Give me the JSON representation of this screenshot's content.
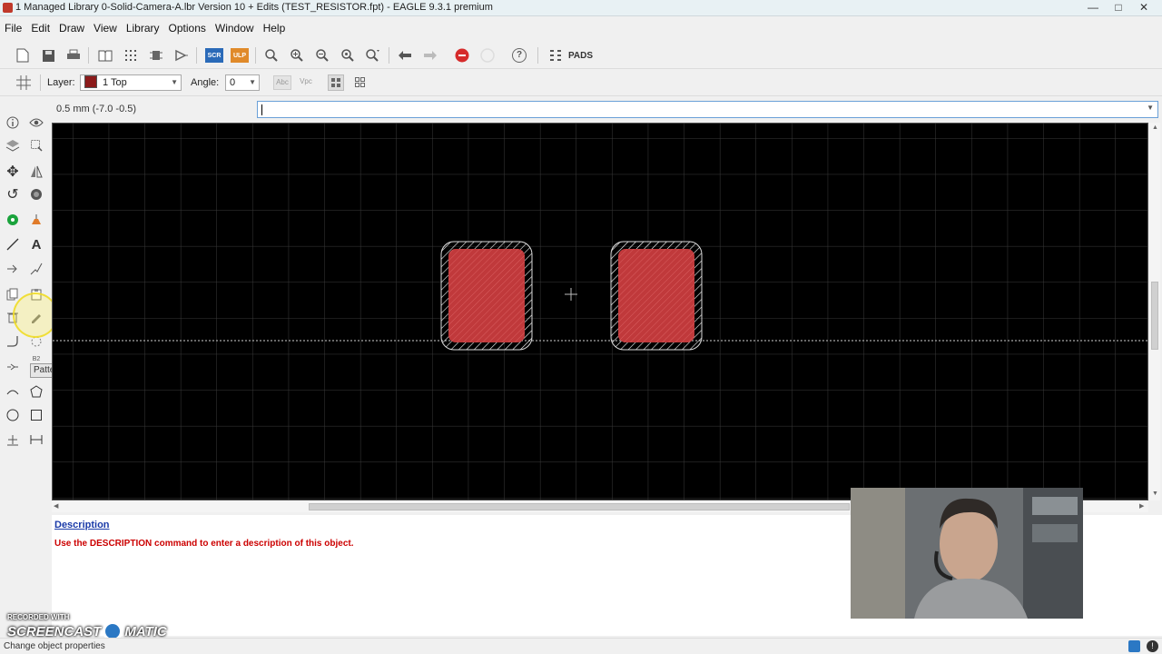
{
  "window": {
    "title": "1 Managed Library 0-Solid-Camera-A.lbr Version 10 + Edits (TEST_RESISTOR.fpt) - EAGLE 9.3.1 premium",
    "minimize": "—",
    "maximize": "□",
    "close": "✕"
  },
  "menu": [
    "File",
    "Edit",
    "Draw",
    "View",
    "Library",
    "Options",
    "Window",
    "Help"
  ],
  "toolbar": {
    "scr_label": "SCR",
    "ulp_label": "ULP",
    "help_glyph": "?",
    "pads_label": "PADS"
  },
  "parambar": {
    "layer_label": "Layer:",
    "layer_value": "1 Top",
    "layer_color": "#8b1a1a",
    "angle_label": "Angle:",
    "angle_value": "0",
    "abc_label": "Abc",
    "vpc_label": "Vpc"
  },
  "coordinates": "0.5 mm (-7.0 -0.5)",
  "command_input": "",
  "tooltip": "Pattern",
  "left_tool_label": "B2",
  "description": {
    "heading": "Description",
    "text": "Use the DESCRIPTION command to enter a description of this object."
  },
  "status": "Change object properties",
  "watermark": {
    "line1": "RECORDED WITH",
    "line2": "SCREENCAST",
    "line3": "MATIC"
  },
  "colors": {
    "pad_fill": "#c0393b",
    "canvas_bg": "#000000",
    "description_text": "#cc0000",
    "link_blue": "#1a3aa8"
  }
}
